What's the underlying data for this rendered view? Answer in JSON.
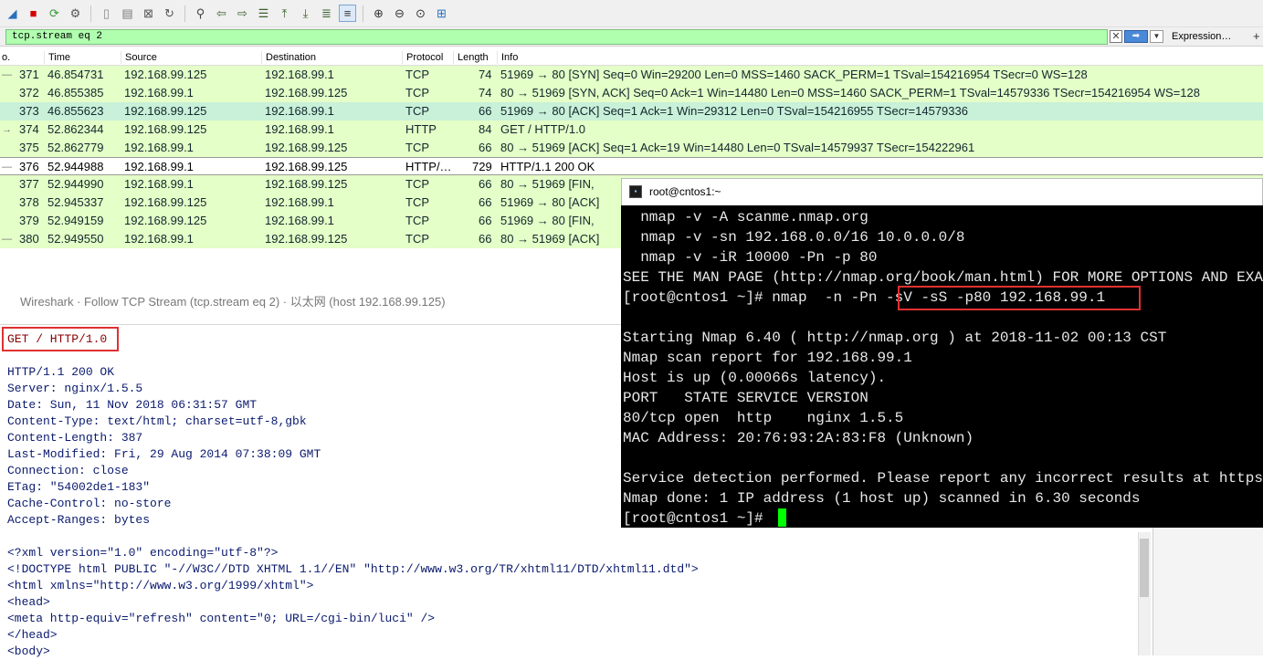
{
  "toolbar": {
    "icons": [
      "shark-fin-icon",
      "stop-icon",
      "restart-icon",
      "options-icon",
      "open-icon",
      "save-icon",
      "close-file-icon",
      "reload-icon",
      "find-icon",
      "back-icon",
      "forward-icon",
      "go-to-icon",
      "first-icon",
      "last-icon",
      "autoscroll-icon",
      "colorize-icon",
      "zoom-in-icon",
      "zoom-out-icon",
      "zoom-reset-icon",
      "resize-columns-icon"
    ]
  },
  "filter": {
    "value": "tcp.stream eq 2",
    "clear_glyph": "✕",
    "apply_glyph": "➡",
    "dropdown_glyph": "▼",
    "expression_label": "Expression…",
    "plus_label": "+"
  },
  "packet_list": {
    "columns": [
      "o.",
      "Time",
      "Source",
      "Destination",
      "Protocol",
      "Length",
      "Info"
    ],
    "rows": [
      {
        "marker": "—",
        "no": "371",
        "time": "46.854731",
        "src": "192.168.99.125",
        "dst": "192.168.99.1",
        "proto": "TCP",
        "len": "74",
        "info": "51969 → 80 [SYN] Seq=0 Win=29200 Len=0 MSS=1460 SACK_PERM=1 TSval=154216954 TSecr=0 WS=128"
      },
      {
        "marker": "",
        "no": "372",
        "time": "46.855385",
        "src": "192.168.99.1",
        "dst": "192.168.99.125",
        "proto": "TCP",
        "len": "74",
        "info": "80 → 51969 [SYN, ACK] Seq=0 Ack=1 Win=14480 Len=0 MSS=1460 SACK_PERM=1 TSval=14579336 TSecr=154216954 WS=128"
      },
      {
        "marker": "",
        "no": "373",
        "time": "46.855623",
        "src": "192.168.99.125",
        "dst": "192.168.99.1",
        "proto": "TCP",
        "len": "66",
        "info": "51969 → 80 [ACK] Seq=1 Ack=1 Win=29312 Len=0 TSval=154216955 TSecr=14579336"
      },
      {
        "marker": "→",
        "no": "374",
        "time": "52.862344",
        "src": "192.168.99.125",
        "dst": "192.168.99.1",
        "proto": "HTTP",
        "len": "84",
        "info": "GET / HTTP/1.0"
      },
      {
        "marker": "",
        "no": "375",
        "time": "52.862779",
        "src": "192.168.99.1",
        "dst": "192.168.99.125",
        "proto": "TCP",
        "len": "66",
        "info": "80 → 51969 [ACK] Seq=1 Ack=19 Win=14480 Len=0 TSval=14579937 TSecr=154222961"
      },
      {
        "marker": "—",
        "no": "376",
        "time": "52.944988",
        "src": "192.168.99.1",
        "dst": "192.168.99.125",
        "proto": "HTTP/…",
        "len": "729",
        "info": "HTTP/1.1 200 OK"
      },
      {
        "marker": "",
        "no": "377",
        "time": "52.944990",
        "src": "192.168.99.1",
        "dst": "192.168.99.125",
        "proto": "TCP",
        "len": "66",
        "info": "80 → 51969 [FIN,"
      },
      {
        "marker": "",
        "no": "378",
        "time": "52.945337",
        "src": "192.168.99.125",
        "dst": "192.168.99.1",
        "proto": "TCP",
        "len": "66",
        "info": "51969 → 80 [ACK]"
      },
      {
        "marker": "",
        "no": "379",
        "time": "52.949159",
        "src": "192.168.99.125",
        "dst": "192.168.99.1",
        "proto": "TCP",
        "len": "66",
        "info": "51969 → 80 [FIN,"
      },
      {
        "marker": "—",
        "no": "380",
        "time": "52.949550",
        "src": "192.168.99.1",
        "dst": "192.168.99.125",
        "proto": "TCP",
        "len": "66",
        "info": "80 → 51969 [ACK]"
      }
    ]
  },
  "follow": {
    "title": "Wireshark · Follow TCP Stream (tcp.stream eq 2) · 以太网 (host 192.168.99.125)",
    "request_lines": [
      "GET / HTTP/1.0"
    ],
    "response_lines": [
      "HTTP/1.1 200 OK",
      "Server: nginx/1.5.5",
      "Date: Sun, 11 Nov 2018 06:31:57 GMT",
      "Content-Type: text/html; charset=utf-8,gbk",
      "Content-Length: 387",
      "Last-Modified: Fri, 29 Aug 2014 07:38:09 GMT",
      "Connection: close",
      "ETag: \"54002de1-183\"",
      "Cache-Control: no-store",
      "Accept-Ranges: bytes",
      "",
      "<?xml version=\"1.0\" encoding=\"utf-8\"?>",
      "<!DOCTYPE html PUBLIC \"-//W3C//DTD XHTML 1.1//EN\" \"http://www.w3.org/TR/xhtml11/DTD/xhtml11.dtd\">",
      "<html xmlns=\"http://www.w3.org/1999/xhtml\">",
      "<head>",
      "<meta http-equiv=\"refresh\" content=\"0; URL=/cgi-bin/luci\" />",
      "</head>",
      "<body>"
    ]
  },
  "terminal": {
    "title": "root@cntos1:~",
    "icon_glyph": "▪",
    "lines": [
      "  nmap -v -A scanme.nmap.org",
      "  nmap -v -sn 192.168.0.0/16 10.0.0.0/8",
      "  nmap -v -iR 10000 -Pn -p 80",
      "SEE THE MAN PAGE (http://nmap.org/book/man.html) FOR MORE OPTIONS AND EXAMPLES",
      "[root@cntos1 ~]# nmap  -n -Pn -sV -sS -p80 192.168.99.1",
      "",
      "Starting Nmap 6.40 ( http://nmap.org ) at 2018-11-02 00:13 CST",
      "Nmap scan report for 192.168.99.1",
      "Host is up (0.00066s latency).",
      "PORT   STATE SERVICE VERSION",
      "80/tcp open  http    nginx 1.5.5",
      "MAC Address: 20:76:93:2A:83:F8 (Unknown)",
      "",
      "Service detection performed. Please report any incorrect results at https://nmap.org/submit/ .",
      "Nmap done: 1 IP address (1 host up) scanned in 6.30 seconds",
      "[root@cntos1 ~]# "
    ]
  },
  "colors": {
    "tcp_row": "#e4ffc7",
    "filter_ok": "#afffaf",
    "highlight_box": "#e03030",
    "cursor": "#00ff00"
  }
}
